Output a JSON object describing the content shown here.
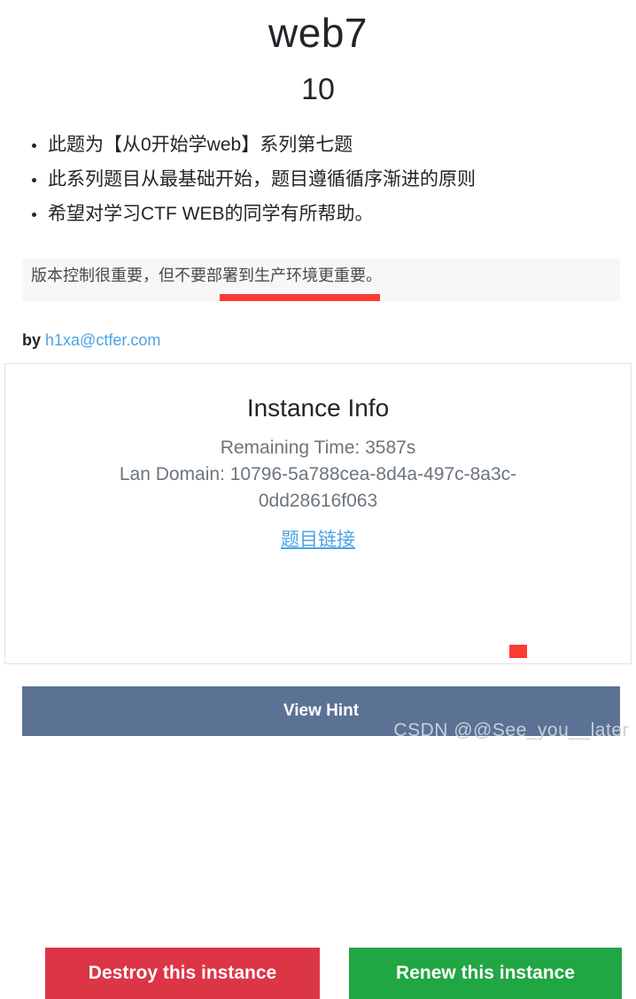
{
  "header": {
    "title": "web7",
    "subtitle": "10"
  },
  "description": {
    "items": [
      "此题为【从0开始学web】系列第七题",
      "此系列题目从最基础开始，题目遵循循序渐进的原则",
      "希望对学习CTF WEB的同学有所帮助。"
    ]
  },
  "hint_panel": {
    "text": "版本控制很重要，但不要部署到生产环境更重要。"
  },
  "author": {
    "prefix": "by ",
    "email": "h1xa@ctfer.com"
  },
  "instance": {
    "title": "Instance Info",
    "remaining_time": "Remaining Time: 3587s",
    "lan_domain": "Lan Domain: 10796-5a788cea-8d4a-497c-8a3c-0dd28616f063",
    "link_label": "题目链接"
  },
  "actions": {
    "destroy_label": "Destroy this instance",
    "renew_label": "Renew this instance",
    "view_hint_label": "View Hint"
  },
  "watermark": {
    "text": "CSDN @@See_you__later"
  },
  "colors": {
    "destroy": "#dc3545",
    "renew": "#21a644",
    "view_hint": "#5b7294",
    "annotation": "#fa3c35",
    "link": "#4ba3e3",
    "muted_text": "#6c757d",
    "hint_background": "#f7f7f7"
  }
}
